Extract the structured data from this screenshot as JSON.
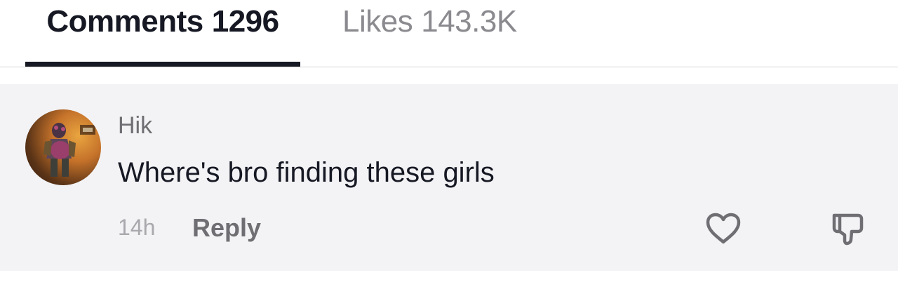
{
  "tabs": {
    "comments": {
      "label": "Comments",
      "count": "1296"
    },
    "likes": {
      "label": "Likes",
      "count": "143.3K"
    }
  },
  "comment": {
    "username": "Hik",
    "text": "Where's bro finding these girls",
    "timestamp": "14h",
    "reply_label": "Reply",
    "avatar": "game-character-avatar"
  },
  "icons": {
    "like": "heart-icon",
    "dislike": "thumbs-down-icon"
  },
  "colors": {
    "active_tab": "#161823",
    "inactive_tab": "#8a8a8f",
    "comment_bg": "#f3f3f5",
    "muted_text": "#6f6f73"
  }
}
